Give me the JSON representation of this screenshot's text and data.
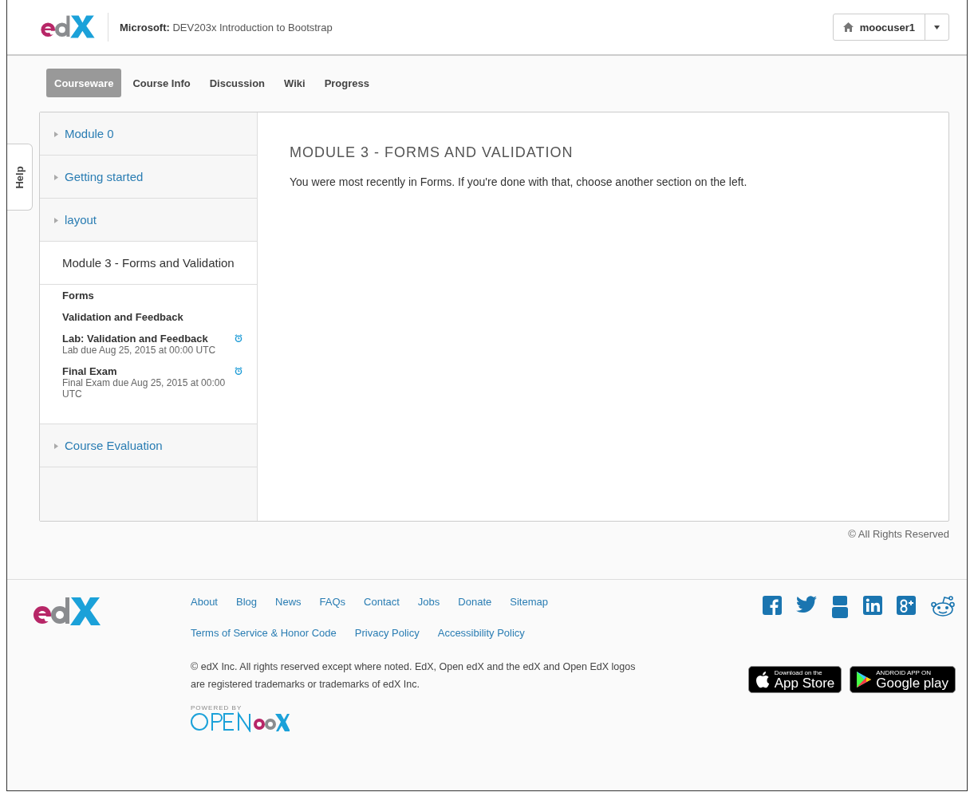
{
  "header": {
    "org": "Microsoft:",
    "course": "DEV203x Introduction to Bootstrap",
    "user": "moocuser1"
  },
  "tabs": [
    {
      "label": "Courseware",
      "selected": true
    },
    {
      "label": "Course Info",
      "selected": false
    },
    {
      "label": "Discussion",
      "selected": false
    },
    {
      "label": "Wiki",
      "selected": false
    },
    {
      "label": "Progress",
      "selected": false
    }
  ],
  "help_tab": "Help",
  "sidebar": {
    "chapters": [
      {
        "title": "Module 0",
        "expanded": false
      },
      {
        "title": "Getting started",
        "expanded": false
      },
      {
        "title": "layout",
        "expanded": false
      },
      {
        "title": "Module 3 - Forms and Validation",
        "expanded": true,
        "sections": [
          {
            "title": "Forms"
          },
          {
            "title": "Validation and Feedback"
          },
          {
            "title": "Lab: Validation and Feedback",
            "due": "Lab due Aug 25, 2015 at 00:00 UTC"
          },
          {
            "title": "Final Exam",
            "due": "Final Exam due Aug 25, 2015 at 00:00 UTC"
          }
        ]
      },
      {
        "title": "Course Evaluation",
        "expanded": false
      }
    ]
  },
  "content": {
    "heading": "MODULE 3 - FORMS AND VALIDATION",
    "message": "You were most recently in Forms. If you're done with that, choose another section on the left."
  },
  "copyright": "© All Rights Reserved",
  "footer": {
    "links_row_1": [
      "About",
      "Blog",
      "News",
      "FAQs",
      "Contact",
      "Jobs",
      "Donate",
      "Sitemap"
    ],
    "links_row_2": [
      "Terms of Service & Honor Code",
      "Privacy Policy",
      "Accessibility Policy"
    ],
    "legal": "© edX Inc. All rights reserved except where noted. EdX, Open edX and the edX and Open EdX logos are registered trademarks or trademarks of edX Inc.",
    "powered_by": "POWERED BY",
    "app_store": {
      "small": "Download on the",
      "big": "App Store"
    },
    "google_play": {
      "small": "ANDROID APP ON",
      "big": "Google play"
    }
  }
}
